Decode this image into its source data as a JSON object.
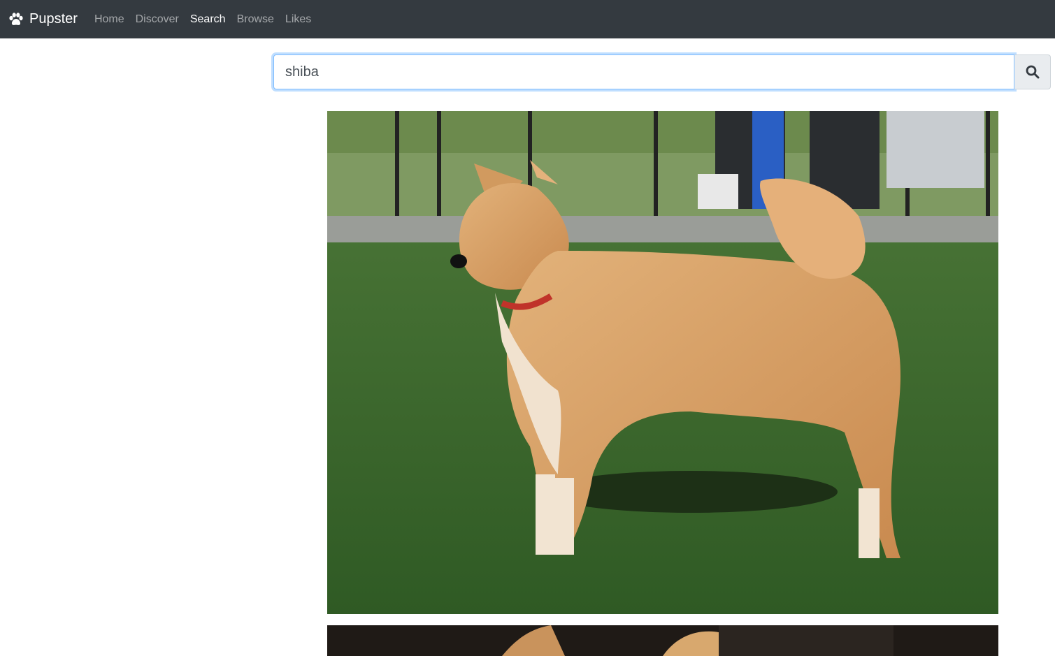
{
  "navbar": {
    "brand": "Pupster",
    "links": [
      {
        "label": "Home",
        "active": false
      },
      {
        "label": "Discover",
        "active": false
      },
      {
        "label": "Search",
        "active": true
      },
      {
        "label": "Browse",
        "active": false
      },
      {
        "label": "Likes",
        "active": false
      }
    ]
  },
  "search": {
    "value": "shiba",
    "button_icon": "search-icon"
  },
  "results": [
    {
      "image": "shiba-inu-standing-on-grass-photo"
    },
    {
      "image": "shiba-inu-close-up-photo"
    }
  ],
  "colors": {
    "navbar_bg": "#343a40",
    "focus_border": "#80bdff",
    "button_bg": "#e9ecef"
  }
}
